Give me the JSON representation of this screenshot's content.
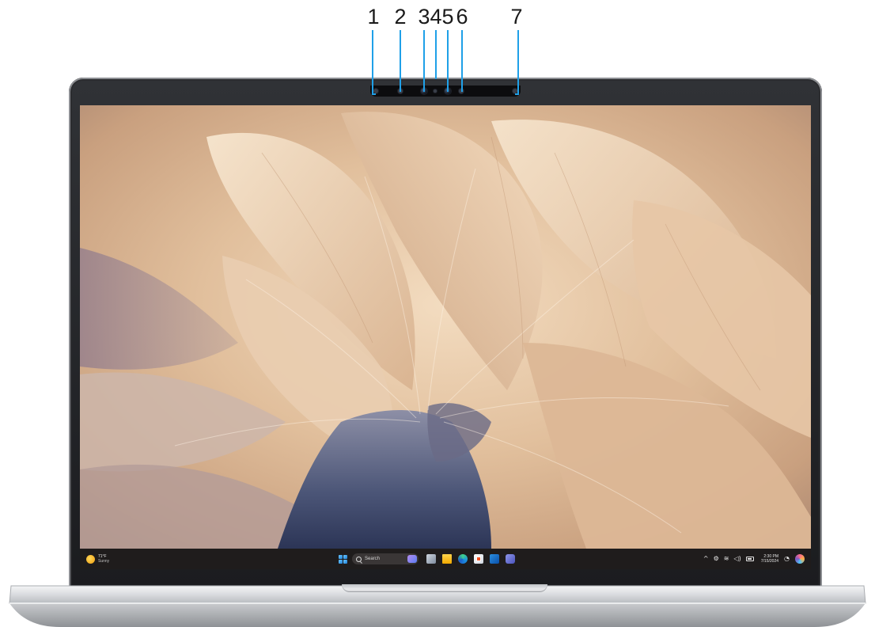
{
  "callouts": [
    "1",
    "2",
    "3",
    "4",
    "5",
    "6",
    "7"
  ],
  "colors": {
    "callout_line": "#1fa0e8",
    "bezel": "#1b1c1f",
    "taskbar": "#1f1c1c",
    "chassis": "#d7d9dc"
  },
  "camera_module": {
    "icons": [
      "ambient-light-sensor-icon",
      "ir-emitter-icon",
      "ir-camera-icon",
      "camera-status-light-icon",
      "rgb-camera-icon",
      "ir-emitter-icon",
      "proximity-sensor-icon"
    ]
  },
  "taskbar": {
    "weather": {
      "icon": "sun-icon",
      "temperature": "71°F",
      "condition": "Sunny"
    },
    "start_icon": "windows-start-icon",
    "search": {
      "label": "Search",
      "icon": "search-icon",
      "badge_icon": "copilot-search-badge-icon"
    },
    "pinned_apps": [
      {
        "name": "task-view-icon"
      },
      {
        "name": "file-explorer-icon"
      },
      {
        "name": "edge-browser-icon"
      },
      {
        "name": "microsoft-store-icon"
      },
      {
        "name": "outlook-icon"
      },
      {
        "name": "teams-icon"
      }
    ],
    "tray": {
      "chevron": "^",
      "icons": [
        "network-icon",
        "wifi-icon",
        "volume-icon",
        "battery-icon",
        "notification-bell-icon",
        "copilot-icon"
      ],
      "time": "2:30 PM",
      "date": "7/15/2024"
    }
  }
}
